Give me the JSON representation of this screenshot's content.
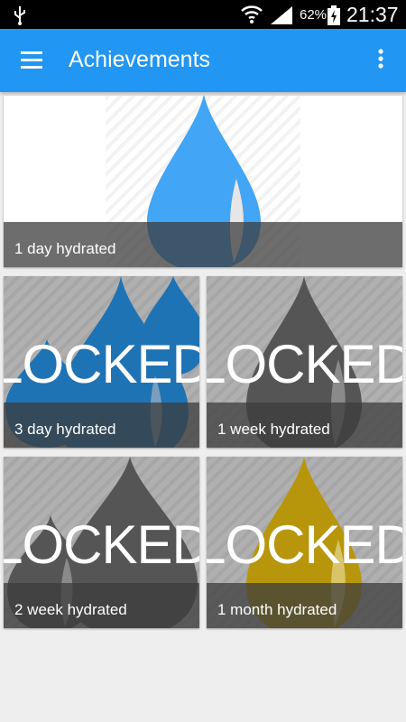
{
  "status_bar": {
    "battery_percent": "62%",
    "time": "21:37",
    "icons": [
      "usb-icon",
      "wifi-icon",
      "signal-icon",
      "battery-charging-icon"
    ]
  },
  "app_bar": {
    "title": "Achievements",
    "background": "#2196F3",
    "icons": [
      "menu-icon",
      "overflow-menu-icon"
    ]
  },
  "achievements": [
    {
      "label": "1 day hydrated",
      "locked": false,
      "drop_color": "#42A5F5"
    },
    {
      "label": "3 day hydrated",
      "locked": true,
      "locked_text": "LOCKED",
      "drop_color": "#1E73B5"
    },
    {
      "label": "1 week hydrated",
      "locked": true,
      "locked_text": "LOCKED",
      "drop_color": "#555555"
    },
    {
      "label": "2 week hydrated",
      "locked": true,
      "locked_text": "LOCKED",
      "drop_color": "#555555"
    },
    {
      "label": "1 month hydrated",
      "locked": true,
      "locked_text": "LOCKED",
      "drop_color": "#B8960C"
    }
  ]
}
